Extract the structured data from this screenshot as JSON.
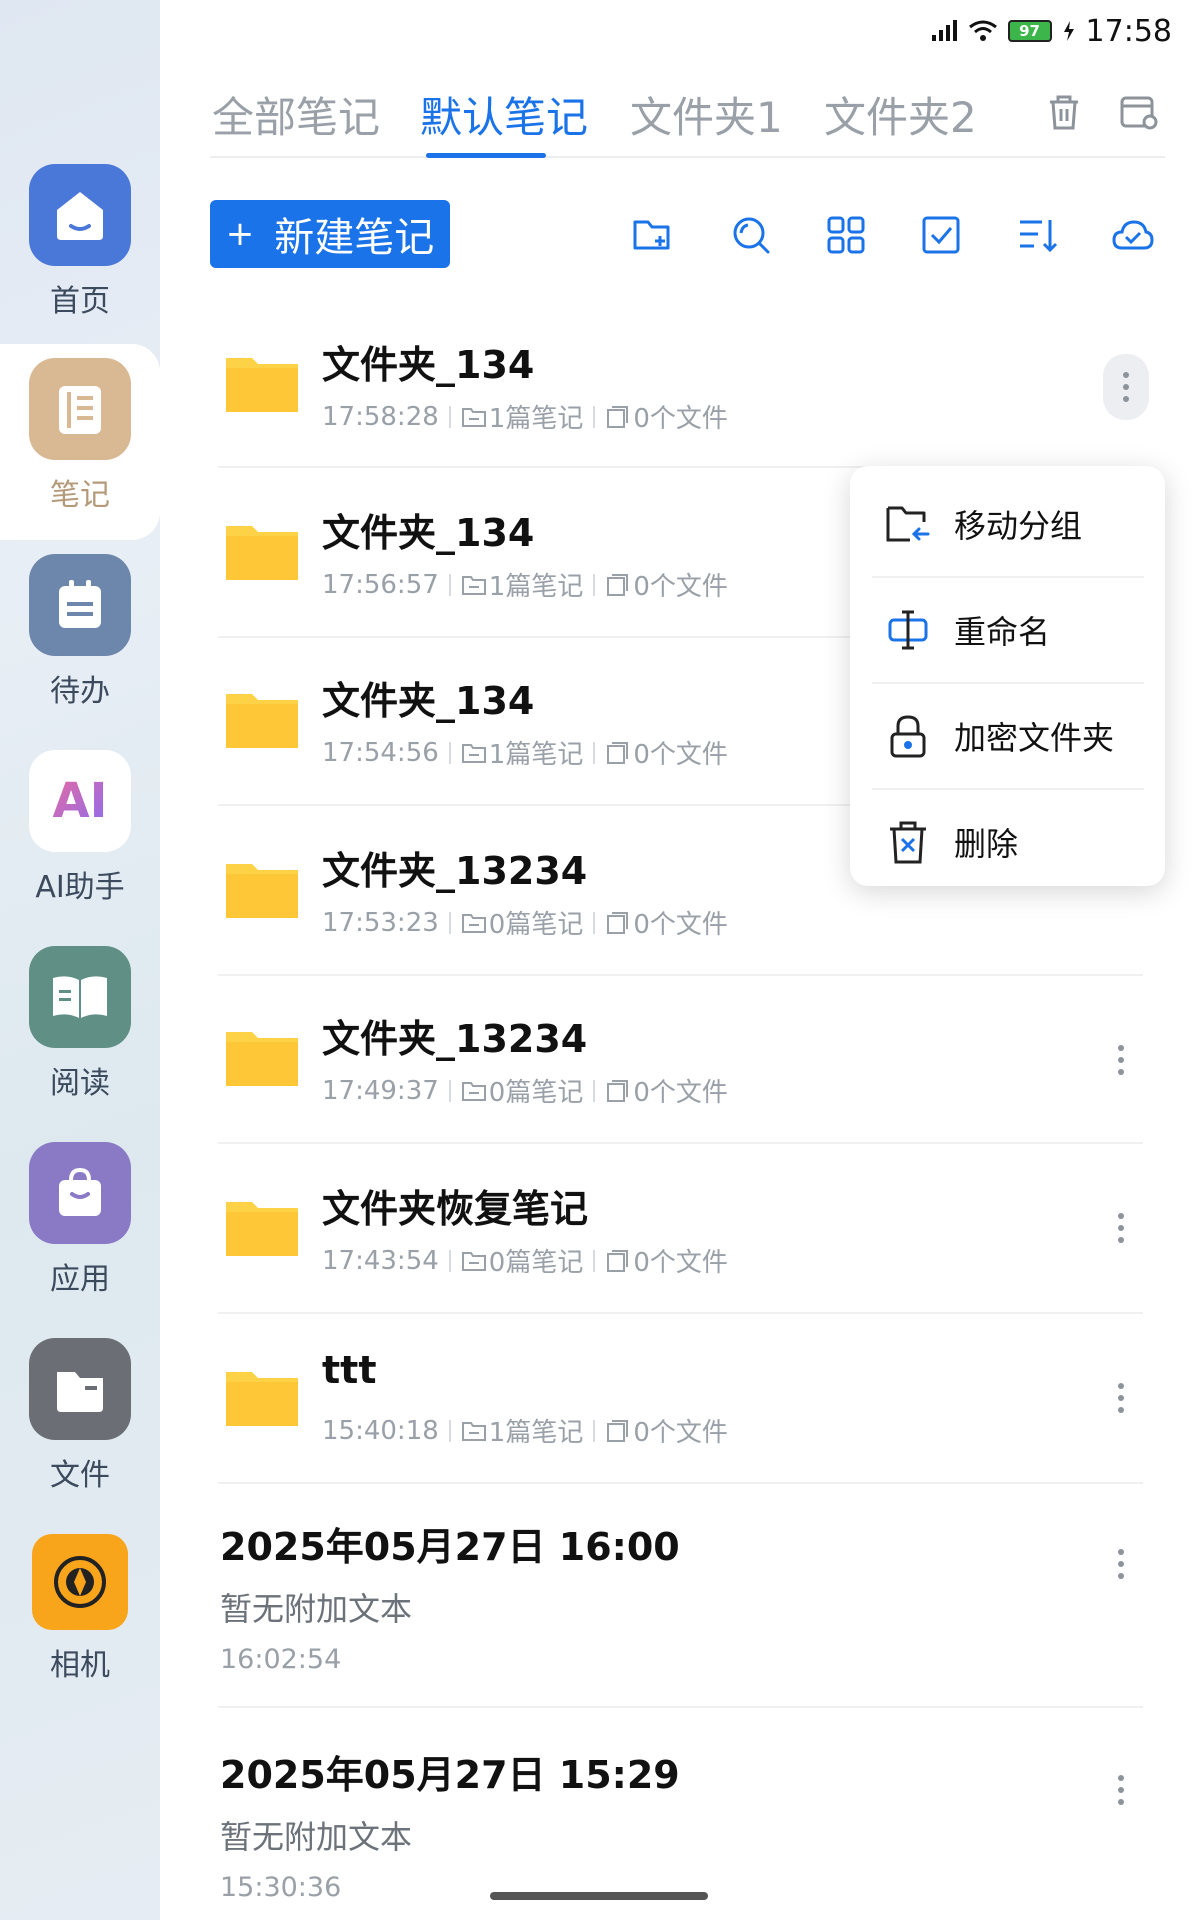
{
  "status": {
    "time": "17:58",
    "battery": "97"
  },
  "sidebar": {
    "items": [
      {
        "label": "首页",
        "icon": "home-icon"
      },
      {
        "label": "笔记",
        "icon": "notebook-icon",
        "active": true
      },
      {
        "label": "待办",
        "icon": "todo-icon"
      },
      {
        "label": "AI助手",
        "icon": "ai-assistant-icon",
        "tile_text": "AI"
      },
      {
        "label": "阅读",
        "icon": "book-icon"
      },
      {
        "label": "应用",
        "icon": "bag-icon"
      },
      {
        "label": "文件",
        "icon": "folder-icon"
      },
      {
        "label": "相机",
        "icon": "camera-icon"
      }
    ]
  },
  "tabs": {
    "items": [
      "全部笔记",
      "默认笔记",
      "文件夹1",
      "文件夹2"
    ],
    "active_index": 1
  },
  "toolbar": {
    "new_note_label": "新建笔记",
    "new_note_plus": "+",
    "icons": [
      "new-folder-icon",
      "search-icon",
      "grid-view-icon",
      "select-icon",
      "sort-icon",
      "cloud-sync-icon"
    ]
  },
  "folders": [
    {
      "title": "文件夹_134",
      "time": "17:58:28",
      "notes": "1篇笔记",
      "files": "0个文件"
    },
    {
      "title": "文件夹_134",
      "time": "17:56:57",
      "notes": "1篇笔记",
      "files": "0个文件"
    },
    {
      "title": "文件夹_134",
      "time": "17:54:56",
      "notes": "1篇笔记",
      "files": "0个文件"
    },
    {
      "title": "文件夹_13234",
      "time": "17:53:23",
      "notes": "0篇笔记",
      "files": "0个文件"
    },
    {
      "title": "文件夹_13234",
      "time": "17:49:37",
      "notes": "0篇笔记",
      "files": "0个文件"
    },
    {
      "title": "文件夹恢复笔记",
      "time": "17:43:54",
      "notes": "0篇笔记",
      "files": "0个文件"
    },
    {
      "title": "ttt",
      "time": "15:40:18",
      "notes": "1篇笔记",
      "files": "0个文件"
    }
  ],
  "notes": [
    {
      "title": "2025年05月27日 16:00",
      "subtitle": "暂无附加文本",
      "time": "16:02:54"
    },
    {
      "title": "2025年05月27日 15:29",
      "subtitle": "暂无附加文本",
      "time": "15:30:36"
    }
  ],
  "context_menu": {
    "items": [
      {
        "label": "移动分组",
        "icon": "move-group-icon"
      },
      {
        "label": "重命名",
        "icon": "rename-icon"
      },
      {
        "label": "加密文件夹",
        "icon": "lock-icon"
      },
      {
        "label": "删除",
        "icon": "delete-icon"
      }
    ]
  },
  "colors": {
    "accent": "#1a73e8",
    "folder": "#fdd247",
    "tab_inactive": "#9aa0a8",
    "sidebar_home": "#4a78d8",
    "sidebar_notes": "#d9b993",
    "sidebar_todo": "#6c87ab",
    "sidebar_read": "#5f8f85",
    "sidebar_apps": "#8a7ac6",
    "sidebar_files": "#6b6f75",
    "sidebar_camera": "#f8a51c"
  }
}
